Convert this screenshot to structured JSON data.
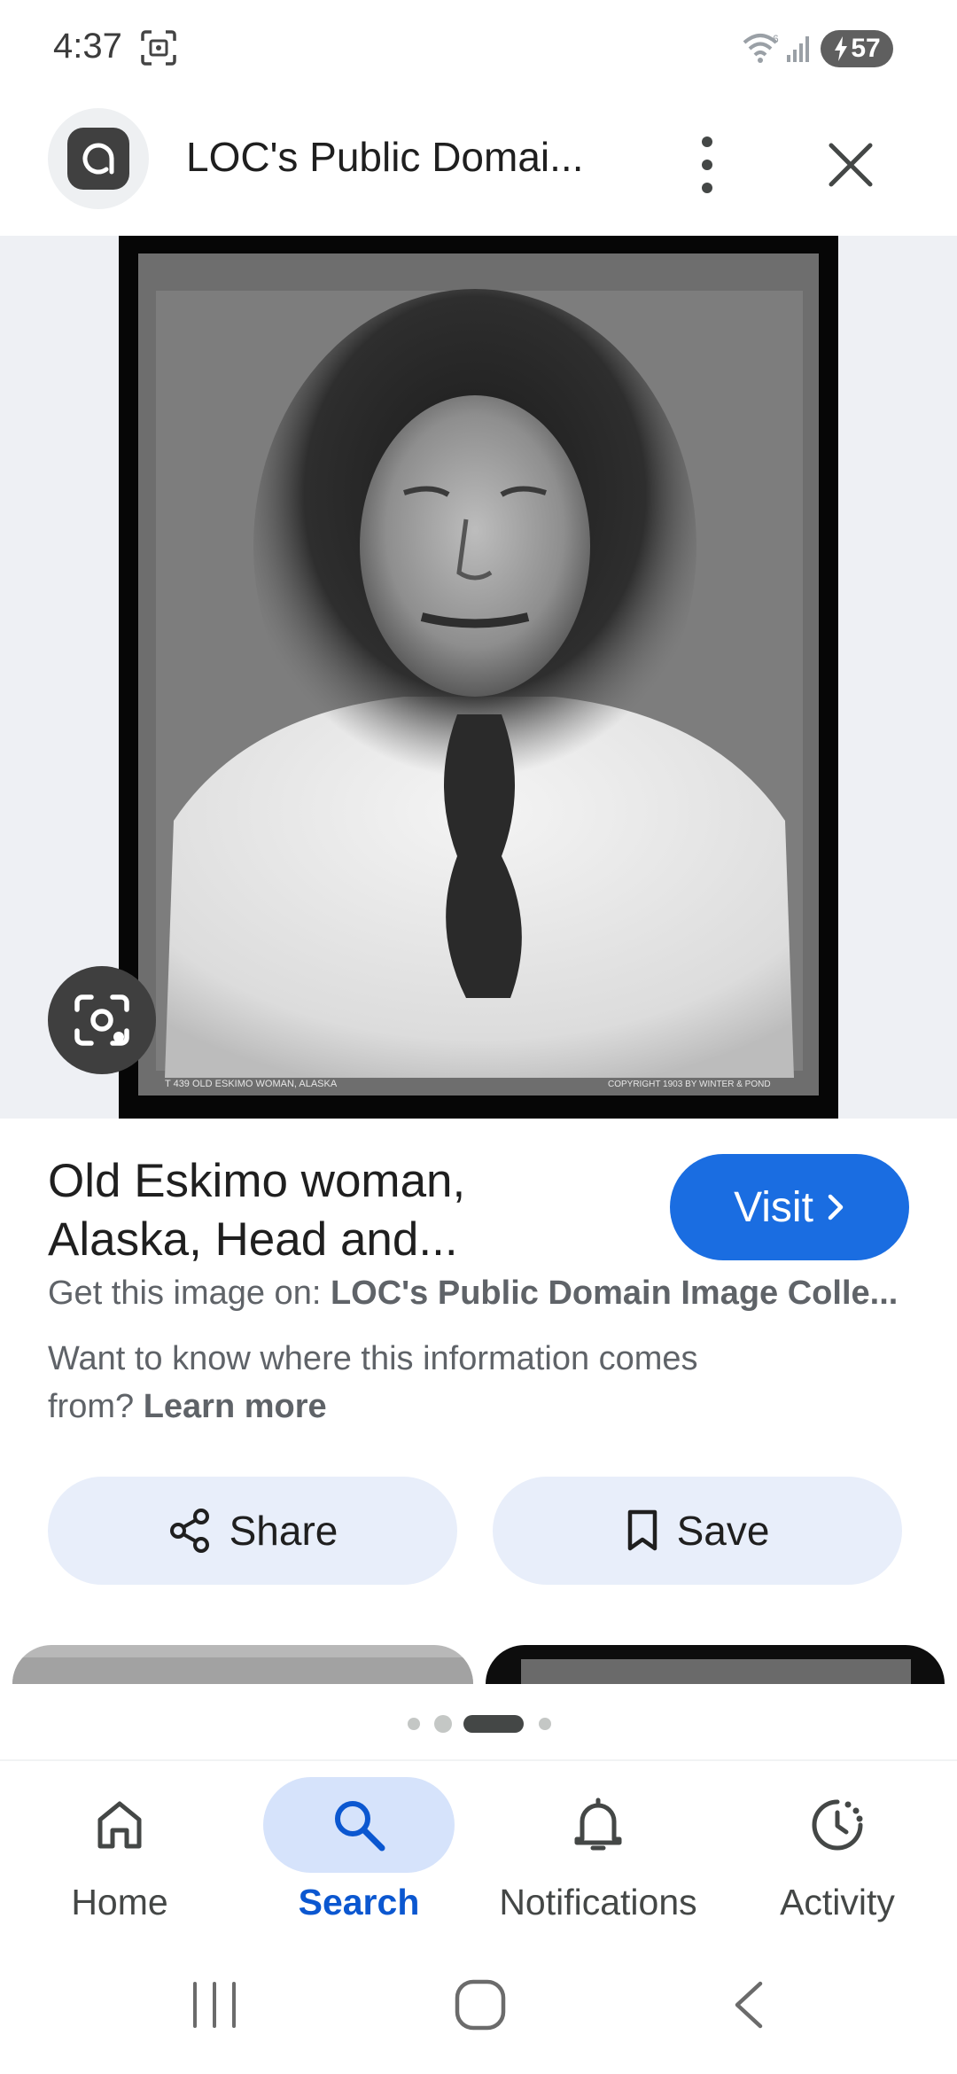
{
  "status_bar": {
    "time": "4:37",
    "battery": "57",
    "icons": [
      "screenshot-icon",
      "wifi-icon",
      "signal-icon",
      "battery-charging-icon"
    ]
  },
  "top_bar": {
    "title": "LOC's Public Domai...",
    "app_icon": "google-lens-app-icon",
    "more_icon": "more-vert-icon",
    "close_icon": "close-icon"
  },
  "image": {
    "caption_left": "T 439   OLD ESKIMO WOMAN, ALASKA",
    "caption_right": "COPYRIGHT 1903 BY WINTER & POND"
  },
  "result": {
    "title": "Old Eskimo woman, Alaska, Head and...",
    "visit_label": "Visit",
    "source_prefix": "Get this image on: ",
    "source_name": "LOC's Public Domain Image Colle...",
    "info_text": "Want to know where this information comes from? ",
    "learn_more": "Learn more"
  },
  "actions": {
    "share_label": "Share",
    "save_label": "Save"
  },
  "carousel": {
    "page_count": 4,
    "active_index": 2
  },
  "bottom_nav": {
    "items": [
      {
        "label": "Home",
        "icon": "home-icon",
        "active": false
      },
      {
        "label": "Search",
        "icon": "search-icon",
        "active": true
      },
      {
        "label": "Notifications",
        "icon": "bell-icon",
        "active": false
      },
      {
        "label": "Activity",
        "icon": "activity-icon",
        "active": false
      }
    ]
  },
  "colors": {
    "accent": "#1a6de1",
    "active_nav": "#0b57d0",
    "pill_bg": "#e8eefa"
  }
}
